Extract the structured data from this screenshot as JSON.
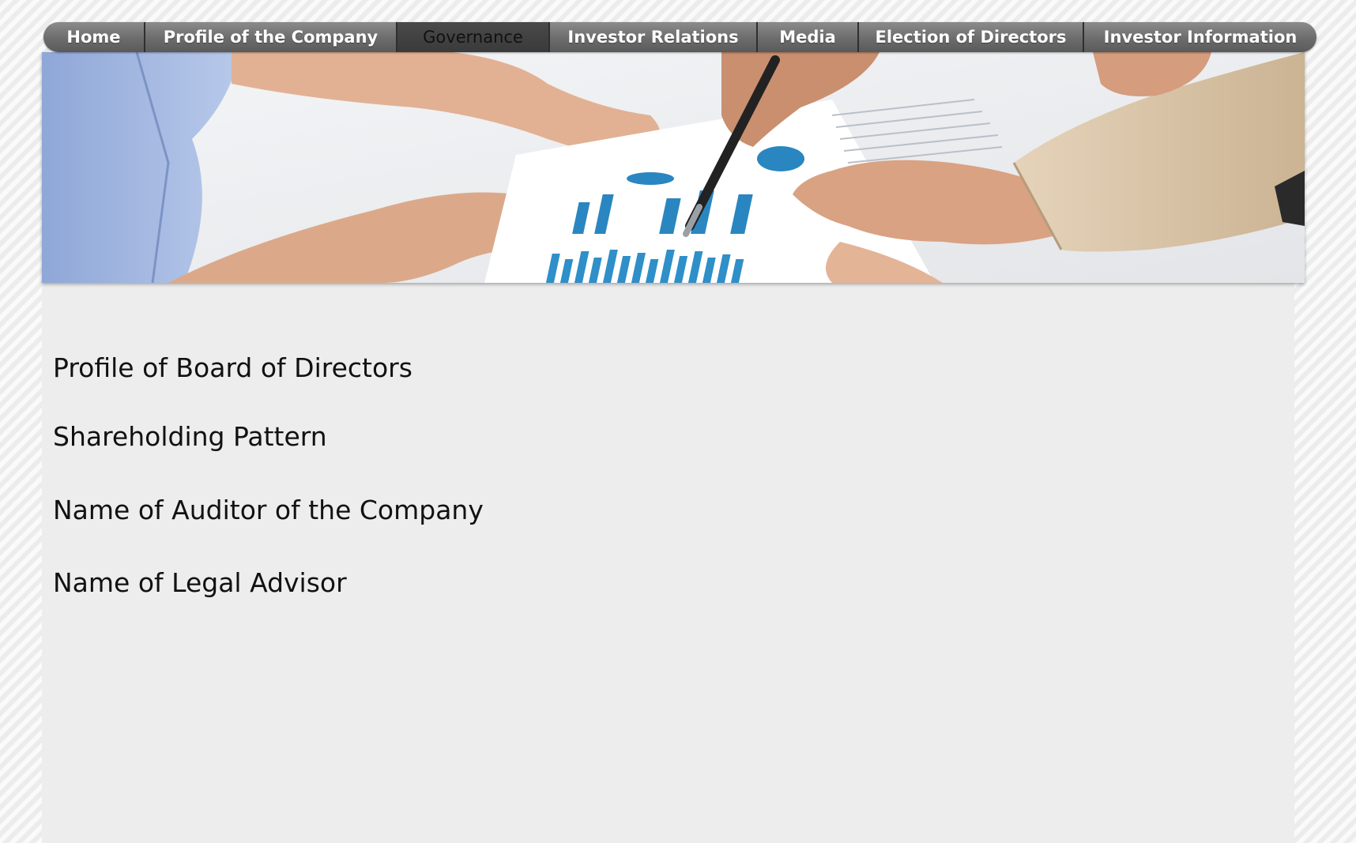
{
  "nav": {
    "items": [
      {
        "label": "Home"
      },
      {
        "label": "Profile of the Company"
      },
      {
        "label": "Governance",
        "active": true
      },
      {
        "label": "Investor Relations"
      },
      {
        "label": "Media"
      },
      {
        "label": "Election of Directors"
      },
      {
        "label": "Investor Information"
      }
    ]
  },
  "content": {
    "links": [
      {
        "label": "Profile of Board of Directors"
      },
      {
        "label": "Shareholding Pattern"
      },
      {
        "label": "Name of Auditor of the Company"
      },
      {
        "label": "Name of Legal Advisor"
      }
    ]
  },
  "colors": {
    "nav_bar": "#6c6c6c",
    "nav_active": "#3a3a3a",
    "content_bg": "#ededed",
    "hero_chart_blue": "#2a86c0"
  }
}
